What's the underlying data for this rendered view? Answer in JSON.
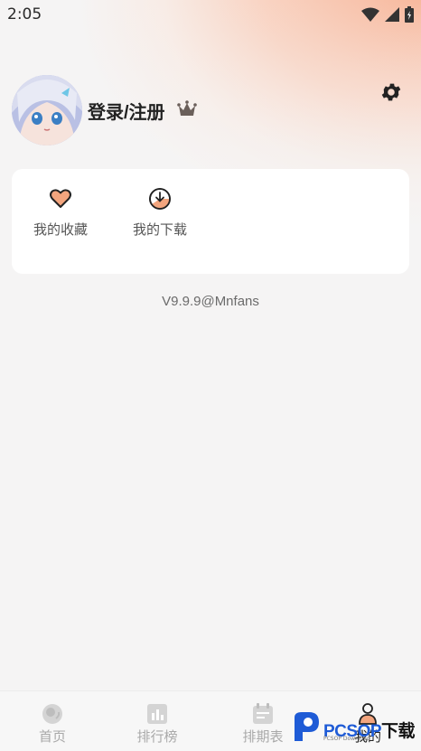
{
  "status_bar": {
    "time": "2:05"
  },
  "profile": {
    "login_label": "登录/注册"
  },
  "shortcuts": [
    {
      "label": "我的收藏",
      "icon": "heart-icon"
    },
    {
      "label": "我的下载",
      "icon": "download-icon"
    }
  ],
  "version": "V9.9.9@Mnfans",
  "tabbar": {
    "tabs": [
      {
        "label": "首页",
        "icon": "home-icon"
      },
      {
        "label": "排行榜",
        "icon": "ranking-icon"
      },
      {
        "label": "排期表",
        "icon": "calendar-icon"
      },
      {
        "label": "我的",
        "icon": "profile-icon",
        "active": true
      }
    ]
  },
  "watermark": {
    "brand": "PCSOP",
    "suffix": "下载",
    "sub": "PCSOP Download"
  },
  "colors": {
    "accent": "#f08a5d",
    "background": "#f5f4f4"
  }
}
